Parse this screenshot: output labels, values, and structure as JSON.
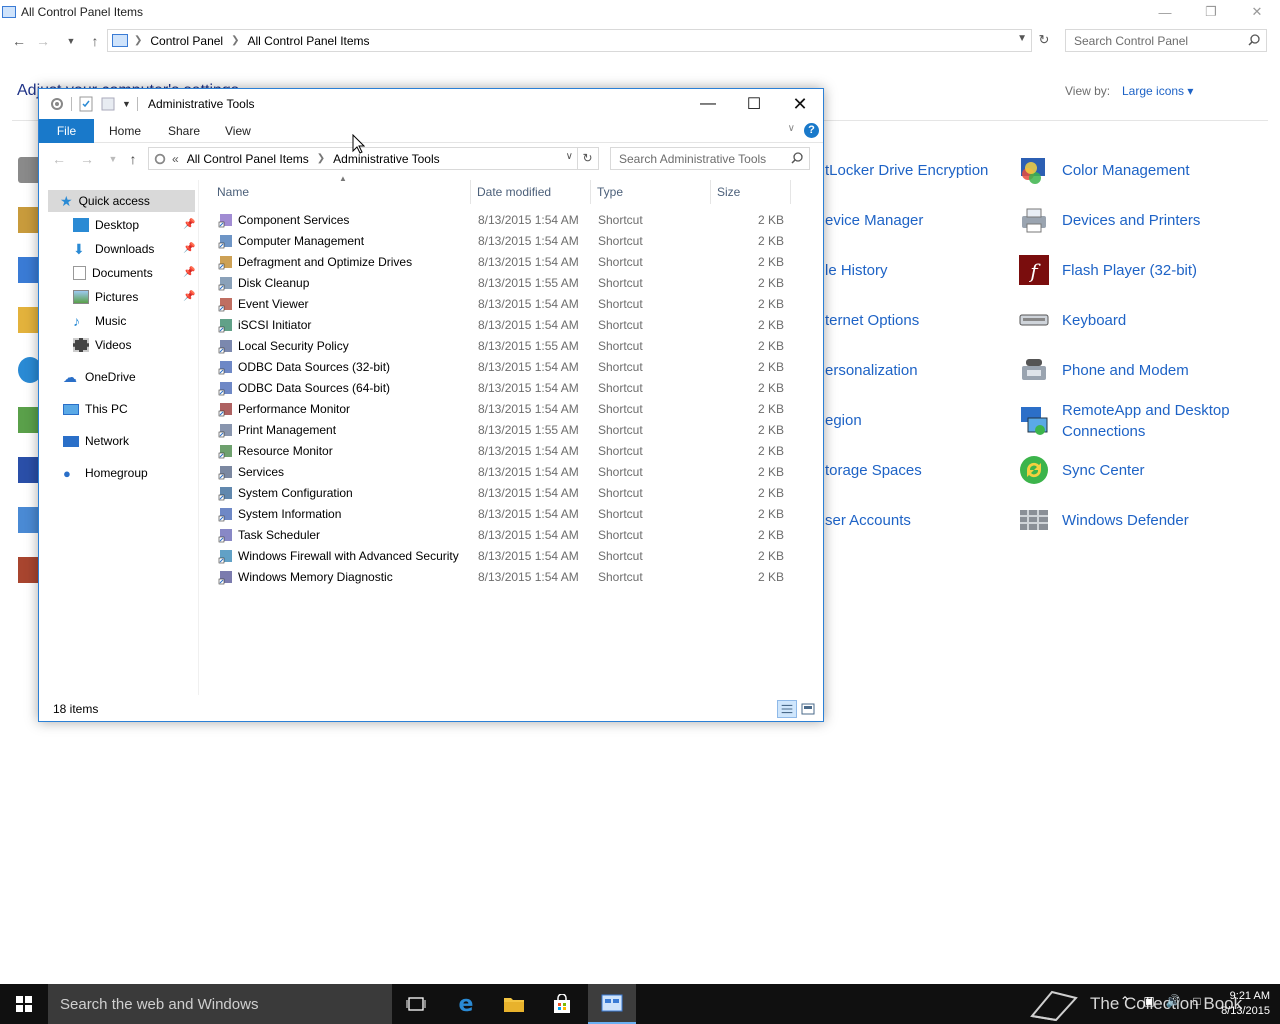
{
  "control_panel": {
    "title": "All Control Panel Items",
    "breadcrumb": [
      "Control Panel",
      "All Control Panel Items"
    ],
    "search_placeholder": "Search Control Panel",
    "heading": "Adjust your computer's settings",
    "view_by_label": "View by:",
    "view_by_value": "Large icons ▾",
    "column2": [
      "tLocker Drive Encryption",
      "evice Manager",
      "le History",
      "ternet Options",
      "ersonalization",
      "egion",
      "torage Spaces",
      "ser Accounts"
    ],
    "column3": [
      "Color Management",
      "Devices and Printers",
      "Flash Player (32-bit)",
      "Keyboard",
      "Phone and Modem",
      "RemoteApp and Desktop",
      "Connections",
      "Sync Center",
      "Windows Defender"
    ]
  },
  "explorer": {
    "title": "Administrative Tools",
    "ribbon_tabs": {
      "file": "File",
      "home": "Home",
      "share": "Share",
      "view": "View"
    },
    "help": "?",
    "breadcrumb": {
      "prefix": "«",
      "parent": "All Control Panel Items",
      "current": "Administrative Tools"
    },
    "search_placeholder": "Search Administrative Tools",
    "nav": {
      "quick_access": "Quick access",
      "desktop": "Desktop",
      "downloads": "Downloads",
      "documents": "Documents",
      "pictures": "Pictures",
      "music": "Music",
      "videos": "Videos",
      "onedrive": "OneDrive",
      "this_pc": "This PC",
      "network": "Network",
      "homegroup": "Homegroup"
    },
    "columns": {
      "name": "Name",
      "date": "Date modified",
      "type": "Type",
      "size": "Size"
    },
    "files": [
      {
        "name": "Component Services",
        "date": "8/13/2015 1:54 AM",
        "type": "Shortcut",
        "size": "2 KB"
      },
      {
        "name": "Computer Management",
        "date": "8/13/2015 1:54 AM",
        "type": "Shortcut",
        "size": "2 KB"
      },
      {
        "name": "Defragment and Optimize Drives",
        "date": "8/13/2015 1:54 AM",
        "type": "Shortcut",
        "size": "2 KB"
      },
      {
        "name": "Disk Cleanup",
        "date": "8/13/2015 1:55 AM",
        "type": "Shortcut",
        "size": "2 KB"
      },
      {
        "name": "Event Viewer",
        "date": "8/13/2015 1:54 AM",
        "type": "Shortcut",
        "size": "2 KB"
      },
      {
        "name": "iSCSI Initiator",
        "date": "8/13/2015 1:54 AM",
        "type": "Shortcut",
        "size": "2 KB"
      },
      {
        "name": "Local Security Policy",
        "date": "8/13/2015 1:55 AM",
        "type": "Shortcut",
        "size": "2 KB"
      },
      {
        "name": "ODBC Data Sources (32-bit)",
        "date": "8/13/2015 1:54 AM",
        "type": "Shortcut",
        "size": "2 KB"
      },
      {
        "name": "ODBC Data Sources (64-bit)",
        "date": "8/13/2015 1:54 AM",
        "type": "Shortcut",
        "size": "2 KB"
      },
      {
        "name": "Performance Monitor",
        "date": "8/13/2015 1:54 AM",
        "type": "Shortcut",
        "size": "2 KB"
      },
      {
        "name": "Print Management",
        "date": "8/13/2015 1:55 AM",
        "type": "Shortcut",
        "size": "2 KB"
      },
      {
        "name": "Resource Monitor",
        "date": "8/13/2015 1:54 AM",
        "type": "Shortcut",
        "size": "2 KB"
      },
      {
        "name": "Services",
        "date": "8/13/2015 1:54 AM",
        "type": "Shortcut",
        "size": "2 KB"
      },
      {
        "name": "System Configuration",
        "date": "8/13/2015 1:54 AM",
        "type": "Shortcut",
        "size": "2 KB"
      },
      {
        "name": "System Information",
        "date": "8/13/2015 1:54 AM",
        "type": "Shortcut",
        "size": "2 KB"
      },
      {
        "name": "Task Scheduler",
        "date": "8/13/2015 1:54 AM",
        "type": "Shortcut",
        "size": "2 KB"
      },
      {
        "name": "Windows Firewall with Advanced Security",
        "date": "8/13/2015 1:54 AM",
        "type": "Shortcut",
        "size": "2 KB"
      },
      {
        "name": "Windows Memory Diagnostic",
        "date": "8/13/2015 1:54 AM",
        "type": "Shortcut",
        "size": "2 KB"
      }
    ],
    "status_count": "18 items"
  },
  "taskbar": {
    "search_placeholder": "Search the web and Windows",
    "watermark": "The Collection Book",
    "time": "9:21 AM",
    "date": "8/13/2015"
  },
  "colors": {
    "accent": "#1979ca",
    "link": "#1e63c6",
    "taskbar": "#101010"
  }
}
